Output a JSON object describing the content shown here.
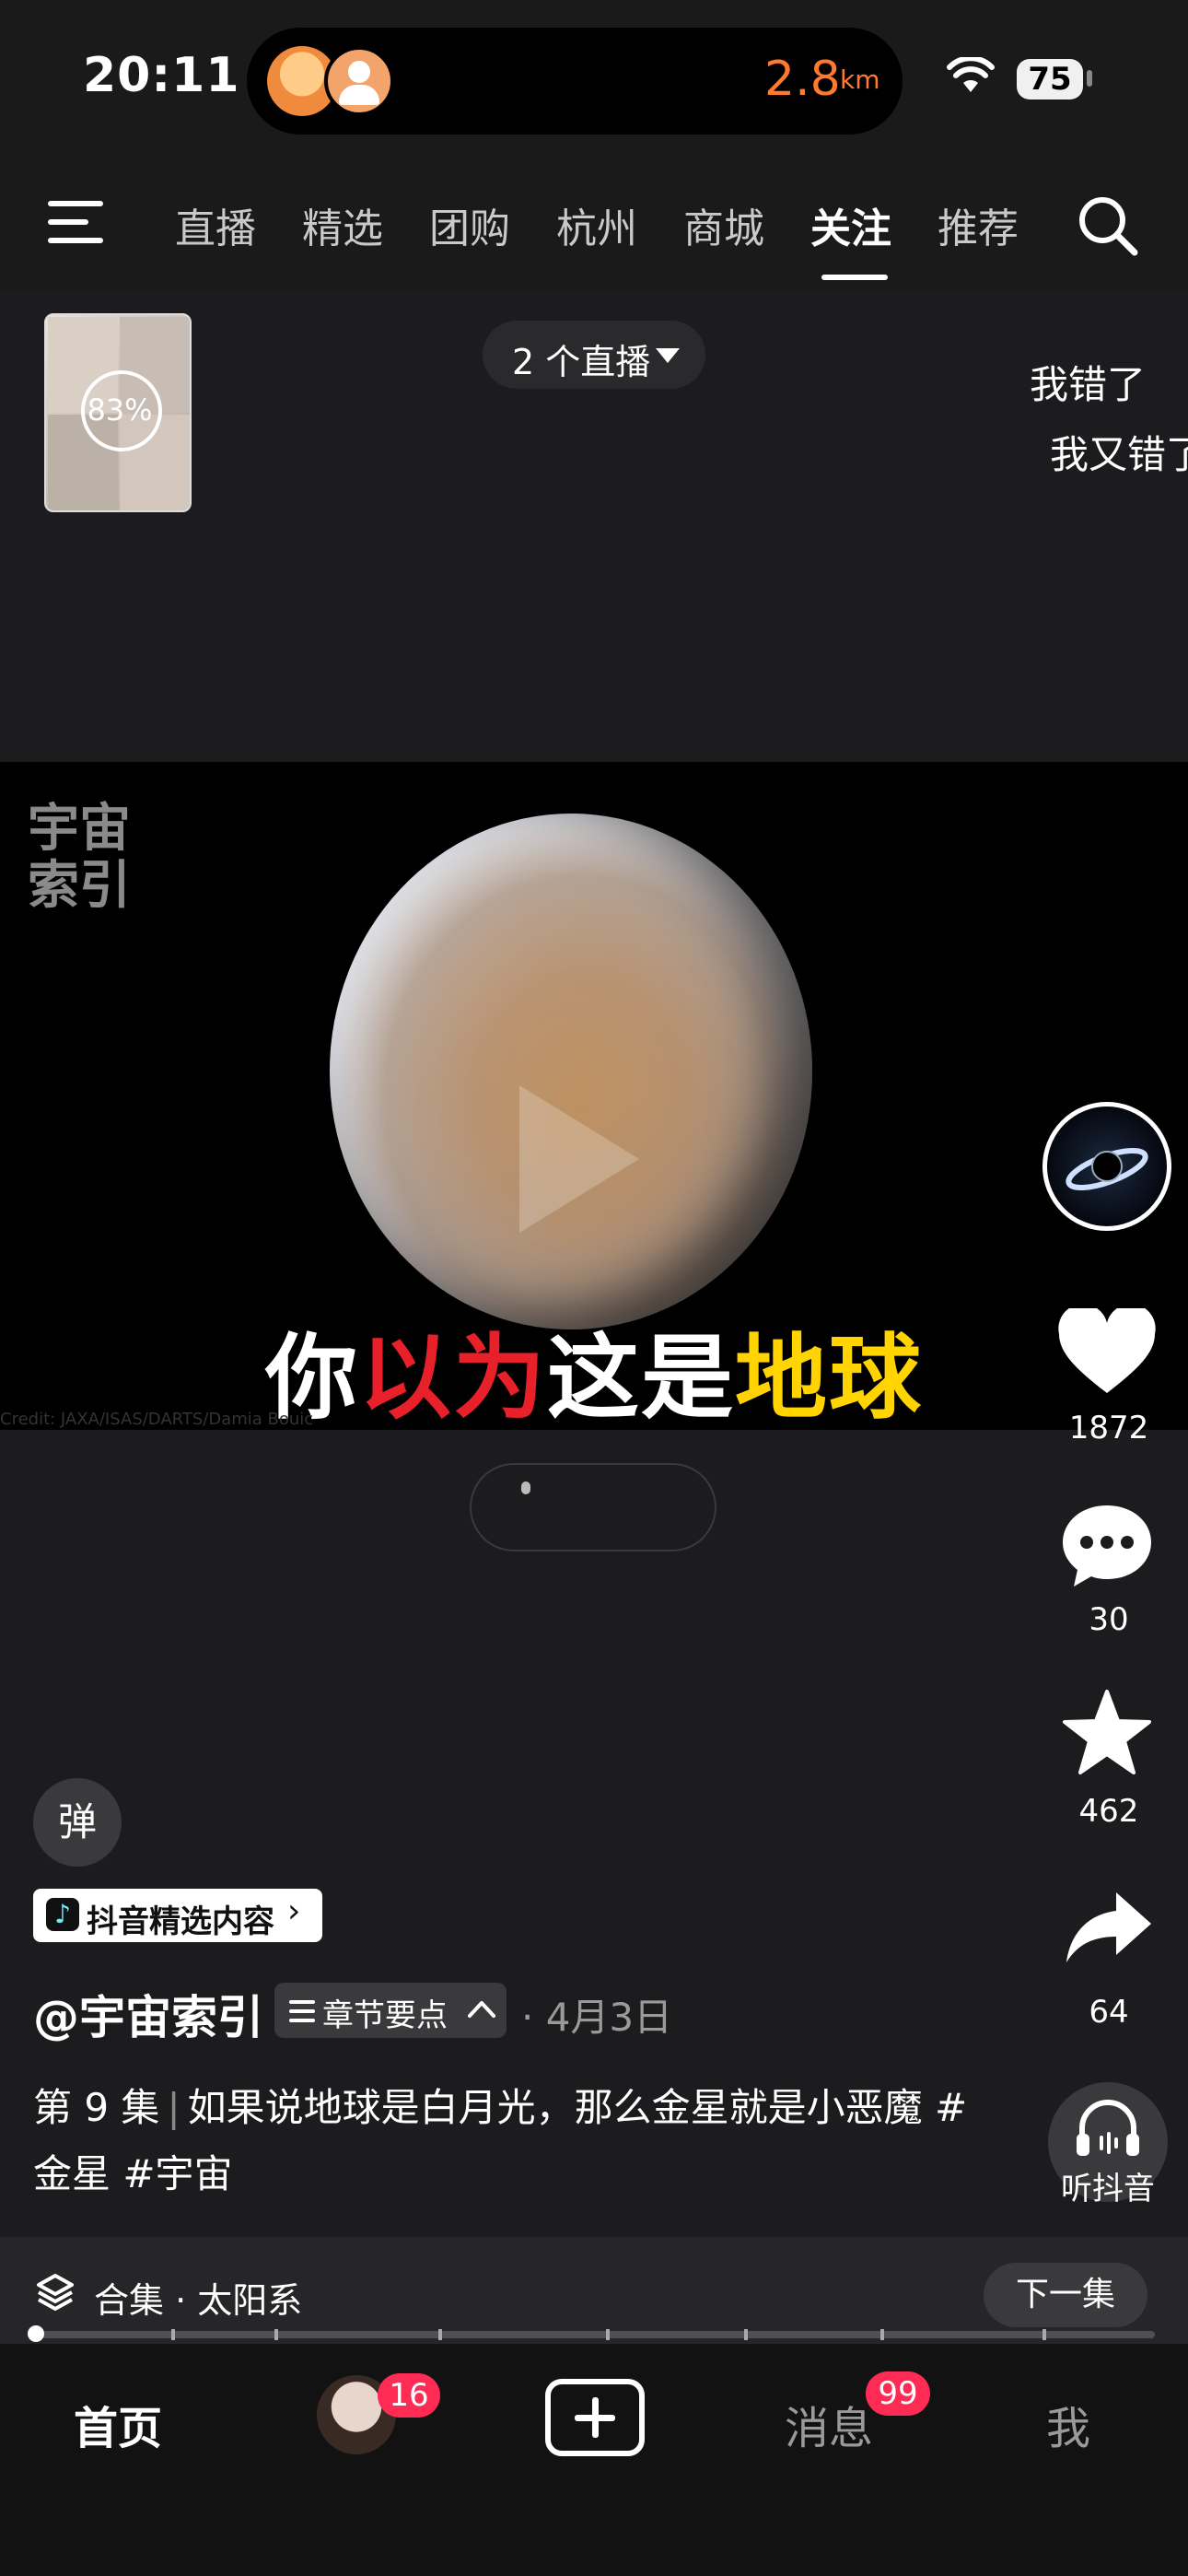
{
  "status_bar": {
    "time": "20:11",
    "distance": "2.8",
    "distance_unit": "km",
    "battery": "75"
  },
  "top_nav": {
    "tabs": [
      {
        "label": "直播",
        "active": false
      },
      {
        "label": "精选",
        "active": false
      },
      {
        "label": "团购",
        "active": false
      },
      {
        "label": "杭州",
        "active": false
      },
      {
        "label": "商城",
        "active": false
      },
      {
        "label": "关注",
        "active": true
      },
      {
        "label": "推荐",
        "active": false
      }
    ]
  },
  "live": {
    "percent": "83%",
    "count_label": "2 个直播",
    "danmu": [
      "我错了",
      "我又错了"
    ]
  },
  "video": {
    "watermark": "宇宙索引",
    "subtitle_parts": [
      {
        "text": "你",
        "color": "white"
      },
      {
        "text": "以为",
        "color": "red"
      },
      {
        "text": "这是",
        "color": "white"
      },
      {
        "text": "地球",
        "color": "yellow"
      }
    ],
    "credit": "Credit: JAXA/ISAS/DARTS/Damia Bouic"
  },
  "actions": {
    "likes": "1872",
    "comments": "30",
    "favorites": "462",
    "shares": "64",
    "listen_label": "听抖音"
  },
  "caption": {
    "danmu_toggle": "弹",
    "badge": "抖音精选内容",
    "author": "@宇宙索引",
    "chapter_label": "章节要点",
    "date": "· 4月3日",
    "episode": "第 9 集",
    "description": "如果说地球是白月光，那么金星就是小恶魔 #金星 #宇宙"
  },
  "collection": {
    "label": "合集 · 太阳系",
    "next_label": "下一集",
    "progress": 0.0
  },
  "tab_bar": {
    "home": "首页",
    "friends_badge": "16",
    "messages": "消息",
    "messages_badge": "99",
    "me": "我"
  },
  "colors": {
    "accent_orange": "#ff7a2e",
    "badge_red": "#fe2c55",
    "subtitle_red": "#e8202a",
    "subtitle_yellow": "#ffd400"
  }
}
